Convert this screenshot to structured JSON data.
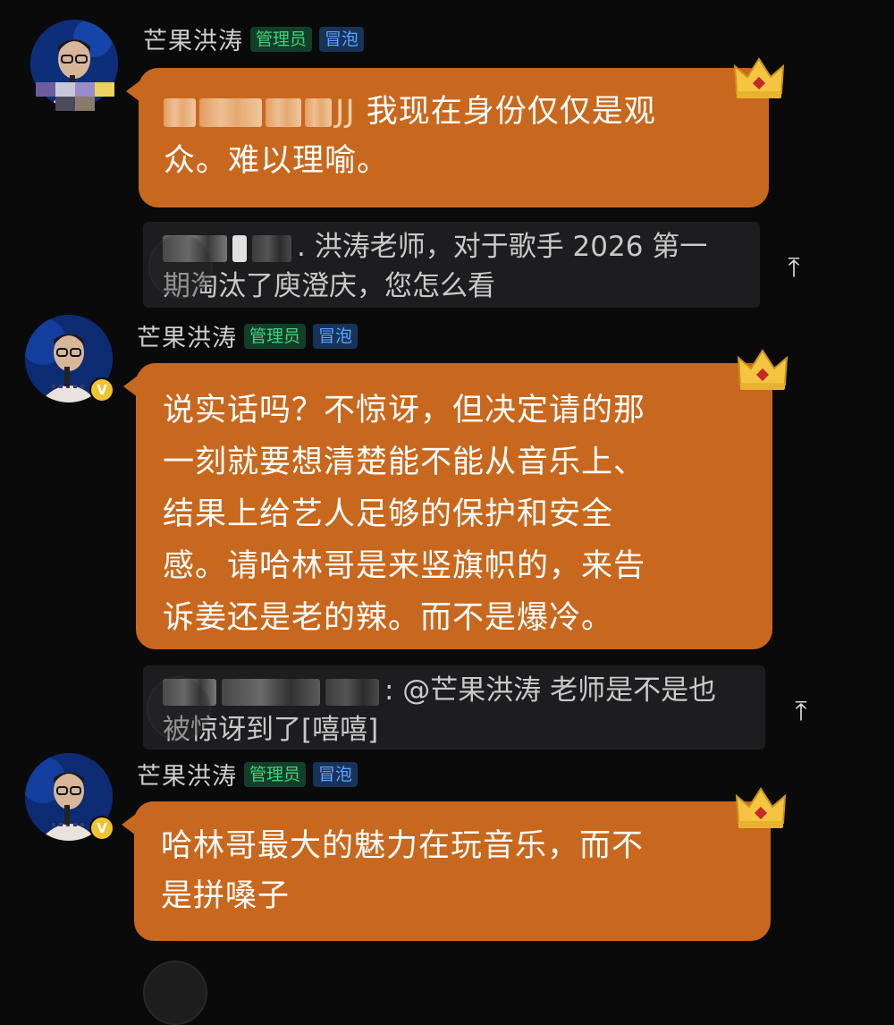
{
  "colors": {
    "background": "#0a0a0b",
    "bubble": "#c8681e",
    "admin_tag_text": "#45d17a",
    "bubble_tag_text": "#5aa4ff"
  },
  "messages": [
    {
      "username": "芒果洪涛",
      "tags": [
        "管理员",
        "冒泡"
      ],
      "mention_suffix": "JJ",
      "text_line1": "我现在身份仅仅是观",
      "text_line2": "众。难以理喻。"
    },
    {
      "username": "芒果洪涛",
      "tags": [
        "管理员",
        "冒泡"
      ],
      "verified_badge": "V",
      "lines": [
        "说实话吗？不惊讶，但决定请的那",
        "一刻就要想清楚能不能从音乐上、",
        "结果上给艺人足够的保护和安全",
        "感。请哈林哥是来竖旗帜的，来告",
        "诉姜还是老的辣。而不是爆冷。"
      ]
    },
    {
      "username": "芒果洪涛",
      "tags": [
        "管理员",
        "冒泡"
      ],
      "verified_badge": "V",
      "lines": [
        "哈林哥最大的魅力在玩音乐，而不",
        "是拼嗓子"
      ]
    }
  ],
  "quotes": [
    {
      "line1": ". 洪涛老师，对于歌手 2026 第一",
      "line2": "期淘汰了庾澄庆，您怎么看",
      "icon": "arrow-up-icon"
    },
    {
      "line1": ": @芒果洪涛 老师是不是也",
      "line2": "被惊讶到了[嘻嘻]",
      "icon": "arrow-up-icon"
    }
  ],
  "icons": {
    "scroll_top": "⤒",
    "crown": "crown-icon"
  }
}
